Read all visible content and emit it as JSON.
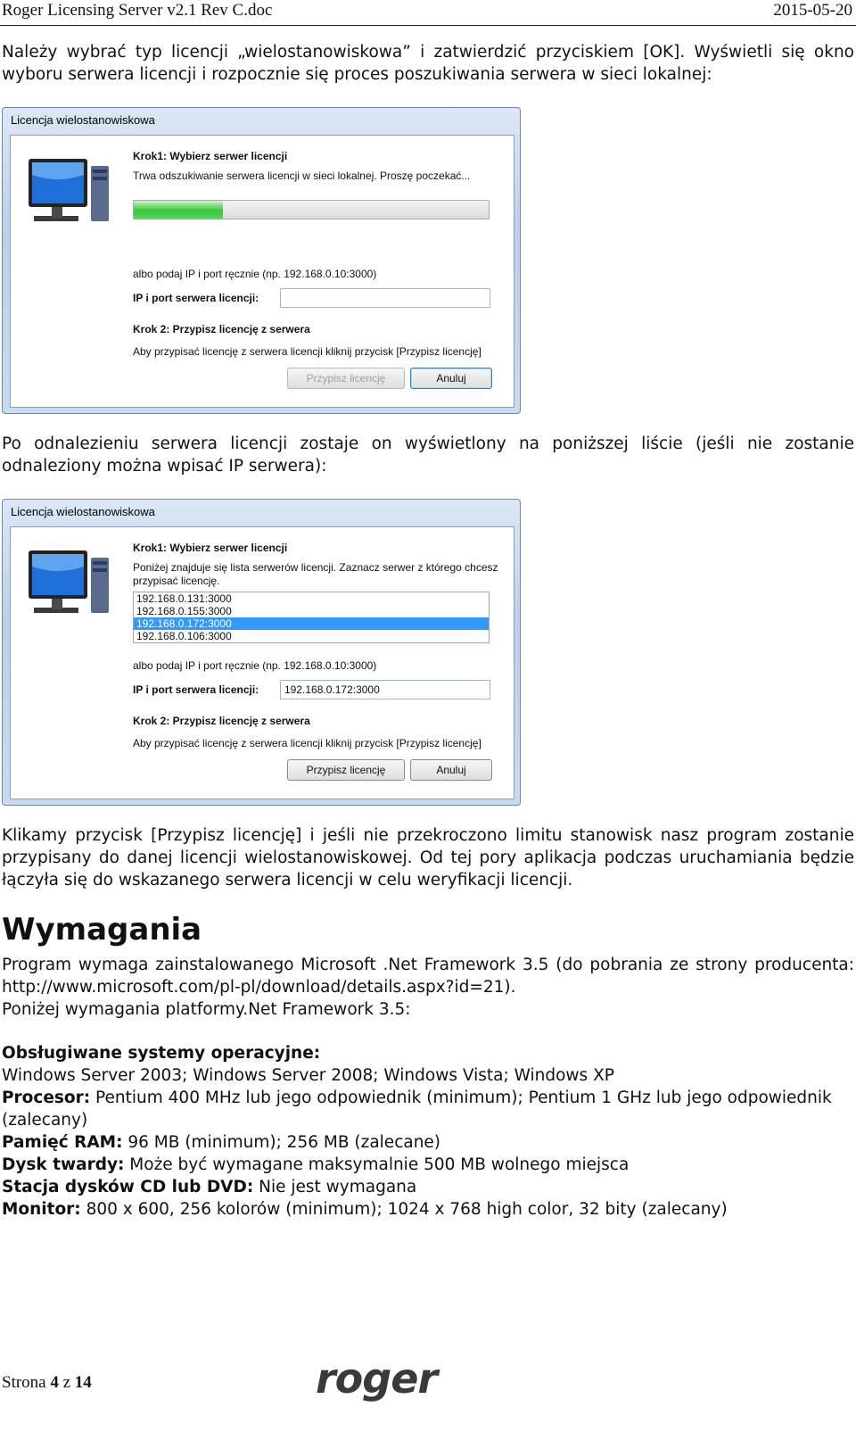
{
  "header": {
    "title": "Roger Licensing Server  v2.1 Rev C.doc",
    "date": "2015-05-20"
  },
  "intro": [
    "Należy wybrać typ licencji „wielostanowiskowa” i zatwierdzić przyciskiem [OK]. Wyświetli się okno",
    "wyboru serwera licencji i rozpocznie się proces poszukiwania serwera w sieci lokalnej:"
  ],
  "dialog1": {
    "title": "Licencja wielostanowiskowa",
    "step1_title": "Krok1: Wybierz serwer licencji",
    "step1_desc": "Trwa odszukiwanie serwera licencji w sieci lokalnej. Proszę poczekać...",
    "progress": 0.25,
    "manual_hint": "albo podaj IP i port ręcznie (np. 192.168.0.10:3000)",
    "ip_label": "IP i port serwera licencji:",
    "ip_value": "",
    "step2_title": "Krok 2: Przypisz licencję z serwera",
    "step2_desc": "Aby przypisać licencję z serwera licencji kliknij przycisk [Przypisz licencję]",
    "assign_button": "Przypisz licencję",
    "cancel_button": "Anuluj"
  },
  "middle": [
    "Po odnalezieniu serwera licencji zostaje on wyświetlony na poniższej liście (jeśli nie zostanie",
    "odnaleziony można wpisać IP serwera):"
  ],
  "dialog2": {
    "title": "Licencja wielostanowiskowa",
    "step1_title": "Krok1: Wybierz serwer licencji",
    "step1_desc_1": "Poniżej znajduje się lista serwerów licencji. Zaznacz serwer z którego chcesz",
    "step1_desc_2": "przypisać licencję.",
    "servers": [
      "192.168.0.131:3000",
      "192.168.0.155:3000",
      "192.168.0.172:3000",
      "192.168.0.106:3000"
    ],
    "selected_index": 2,
    "manual_hint": "albo podaj IP i port ręcznie (np. 192.168.0.10:3000)",
    "ip_label": "IP i port serwera licencji:",
    "ip_value": "192.168.0.172:3000",
    "step2_title": "Krok 2: Przypisz licencję z serwera",
    "step2_desc": "Aby przypisać licencję z serwera licencji kliknij przycisk [Przypisz licencję]",
    "assign_button": "Przypisz licencję",
    "cancel_button": "Anuluj"
  },
  "after": [
    "Klikamy przycisk [Przypisz licencję] i jeśli nie przekroczono limitu stanowisk nasz program zostanie",
    "przypisany do danej licencji wielostanowiskowej. Od tej pory aplikacja podczas uruchamiania będzie",
    "łączyła się do wskazanego serwera licencji w celu weryfikacji licencji."
  ],
  "requirements": {
    "heading": "Wymagania",
    "line1": "Program wymaga zainstalowanego Microsoft .Net Framework 3.5 (do pobrania ze strony producenta:",
    "line2": "http://www.microsoft.com/pl-pl/download/details.aspx?id=21).",
    "line3": "Poniżej wymagania platformy.Net Framework 3.5:",
    "os_label": "Obsługiwane systemy operacyjne:",
    "os_value": "Windows Server 2003; Windows Server 2008; Windows Vista; Windows XP",
    "cpu_label": "Procesor:",
    "cpu_value": " Pentium 400 MHz lub jego odpowiednik (minimum); Pentium 1 GHz lub jego odpowiednik",
    "cpu_value_2": "(zalecany)",
    "ram_label": "Pamięć RAM:",
    "ram_value": " 96 MB (minimum); 256 MB (zalecane)",
    "disk_label": "Dysk twardy:",
    "disk_value": " Może być wymagane maksymalnie 500 MB wolnego miejsca",
    "cd_label": "Stacja dysków CD lub DVD:",
    "cd_value": " Nie jest wymagana",
    "monitor_label": "Monitor:",
    "monitor_value": " 800 x 600, 256 kolorów (minimum); 1024 x 768 high color, 32 bity (zalecany)"
  },
  "footer": {
    "page_prefix": "Strona ",
    "page_num": "4",
    "page_mid": " z ",
    "page_total": "14",
    "logo": "roger"
  }
}
